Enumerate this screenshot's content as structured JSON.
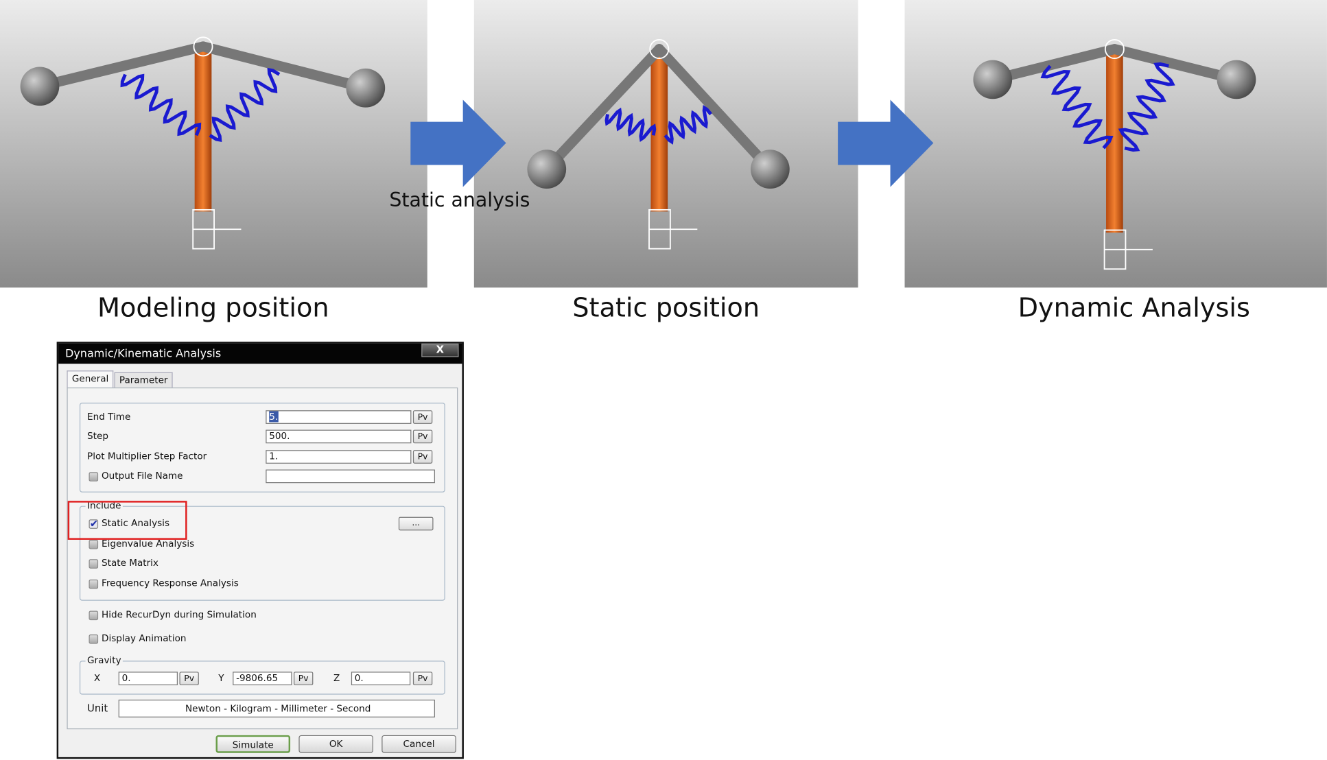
{
  "captions": {
    "modeling": "Modeling position",
    "static": "Static position",
    "dynamic": "Dynamic Analysis",
    "arrow_label": "Static analysis"
  },
  "colors": {
    "arrow": "#4472c4",
    "column": "#e8661e",
    "spring": "#1a1ad0",
    "highlight": "#e02020"
  },
  "dialog": {
    "title": "Dynamic/Kinematic Analysis",
    "close_label": "X",
    "tabs": [
      {
        "label": "General",
        "active": true
      },
      {
        "label": "Parameter",
        "active": false
      }
    ],
    "fields": {
      "end_time": {
        "label": "End Time",
        "value": "5.",
        "button": "Pv"
      },
      "step": {
        "label": "Step",
        "value": "500.",
        "button": "Pv"
      },
      "plot_multiplier": {
        "label": "Plot Multiplier Step Factor",
        "value": "1.",
        "button": "Pv"
      },
      "output_file": {
        "label": "Output File Name",
        "value": "",
        "checked": false
      }
    },
    "include": {
      "legend": "Include",
      "more_button": "...",
      "items": [
        {
          "label": "Static Analysis",
          "checked": true
        },
        {
          "label": "Eigenvalue Analysis",
          "checked": false
        },
        {
          "label": "State Matrix",
          "checked": false
        },
        {
          "label": "Frequency Response Analysis",
          "checked": false
        }
      ]
    },
    "hide_recurdyn": {
      "label": "Hide RecurDyn during Simulation",
      "checked": false
    },
    "display_animation": {
      "label": "Display Animation",
      "checked": false
    },
    "gravity": {
      "legend": "Gravity",
      "x": {
        "label": "X",
        "value": "0.",
        "button": "Pv"
      },
      "y": {
        "label": "Y",
        "value": "-9806.65",
        "button": "Pv"
      },
      "z": {
        "label": "Z",
        "value": "0.",
        "button": "Pv"
      }
    },
    "unit": {
      "label": "Unit",
      "value": "Newton - Kilogram - Millimeter - Second"
    },
    "buttons": {
      "simulate": "Simulate",
      "ok": "OK",
      "cancel": "Cancel"
    }
  }
}
